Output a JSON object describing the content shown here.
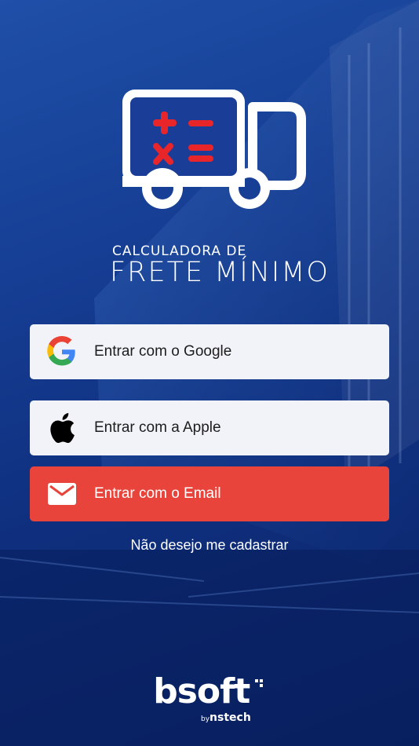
{
  "logo": {
    "line1": "CALCULADORA DE",
    "line2": "FRETE MÍNIMO"
  },
  "buttons": {
    "google": {
      "label": "Entrar com o Google",
      "icon": "google-icon"
    },
    "apple": {
      "label": "Entrar com a Apple",
      "icon": "apple-icon"
    },
    "email": {
      "label": "Entrar com o Email",
      "icon": "mail-icon"
    }
  },
  "skip_link": "Não desejo me cadastrar",
  "brand": {
    "name": "bsoft",
    "by": "by",
    "company": "nstech"
  },
  "colors": {
    "background": "#163f95",
    "button_light": "#f1f3f8",
    "button_email": "#e8443c",
    "logo_red": "#e8262a"
  }
}
